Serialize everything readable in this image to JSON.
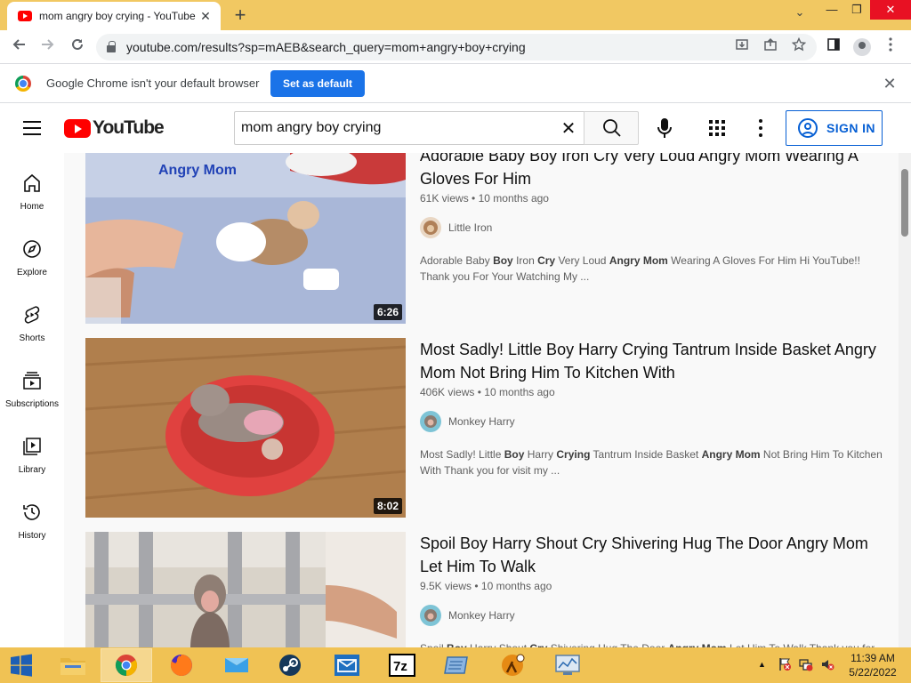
{
  "browser": {
    "tab": {
      "title": "mom angry boy crying - YouTube",
      "close": "✕"
    },
    "new_tab": "+",
    "window": {
      "tab_search": "⌄",
      "minimize": "—",
      "maximize": "❐",
      "close": "✕"
    },
    "address": {
      "url": "youtube.com/results?sp=mAEB&search_query=mom+angry+boy+crying"
    },
    "infobar": {
      "message": "Google Chrome isn't your default browser",
      "button": "Set as default",
      "close": "✕"
    }
  },
  "youtube": {
    "logo_text": "YouTube",
    "search": {
      "query": "mom angry boy crying",
      "clear": "✕"
    },
    "sign_in": "SIGN IN",
    "guide": [
      {
        "label": "Home",
        "icon": "home-icon"
      },
      {
        "label": "Explore",
        "icon": "compass-icon"
      },
      {
        "label": "Shorts",
        "icon": "shorts-icon"
      },
      {
        "label": "Subscriptions",
        "icon": "subscriptions-icon"
      },
      {
        "label": "Library",
        "icon": "library-icon"
      },
      {
        "label": "History",
        "icon": "history-icon"
      }
    ],
    "results": [
      {
        "title": "Adorable Baby Boy Iron Cry Very Loud Angry Mom Wearing A Gloves For Him",
        "views": "61K views",
        "age": "10 months ago",
        "channel": "Little Iron",
        "duration": "6:26",
        "thumb_text": "Angry Mom",
        "description": [
          [
            "Adorable Baby ",
            false
          ],
          [
            "Boy",
            true
          ],
          [
            " Iron ",
            false
          ],
          [
            "Cry",
            true
          ],
          [
            " Very Loud ",
            false
          ],
          [
            "Angry Mom",
            true
          ],
          [
            " Wearing A Gloves For Him Hi YouTube!! Thank you For Your Watching My ...",
            false
          ]
        ]
      },
      {
        "title": "Most Sadly! Little Boy Harry Crying Tantrum Inside Basket Angry Mom Not Bring Him To Kitchen With",
        "views": "406K views",
        "age": "10 months ago",
        "channel": "Monkey Harry",
        "duration": "8:02",
        "description": [
          [
            "Most Sadly! Little ",
            false
          ],
          [
            "Boy",
            true
          ],
          [
            " Harry ",
            false
          ],
          [
            "Crying",
            true
          ],
          [
            " Tantrum Inside Basket ",
            false
          ],
          [
            "Angry Mom",
            true
          ],
          [
            " Not Bring Him To Kitchen With Thank you for visit my ...",
            false
          ]
        ]
      },
      {
        "title": "Spoil Boy Harry Shout Cry Shivering Hug The Door Angry Mom Let Him To Walk",
        "views": "9.5K views",
        "age": "10 months ago",
        "channel": "Monkey Harry",
        "duration": "",
        "description": [
          [
            "Spoil ",
            false
          ],
          [
            "Boy",
            true
          ],
          [
            " Harry Shout ",
            false
          ],
          [
            "Cry",
            true
          ],
          [
            " Shivering Hug The Door ",
            false
          ],
          [
            "Angry Mom",
            true
          ],
          [
            " Let Him To Walk Thank you for ...",
            false
          ]
        ]
      }
    ]
  },
  "taskbar": {
    "apps": [
      "windows-start",
      "file-explorer",
      "chrome",
      "firefox",
      "mail-app",
      "steam",
      "mail",
      "7zip",
      "notepad-app",
      "half-life-2",
      "control-panel"
    ],
    "clock": {
      "time": "11:39 AM",
      "date": "5/22/2022"
    }
  },
  "colors": {
    "youtube_red": "#ff0000",
    "link_blue": "#065fd4",
    "taskbar": "#f0c254",
    "chrome_frame": "#f1c862"
  }
}
